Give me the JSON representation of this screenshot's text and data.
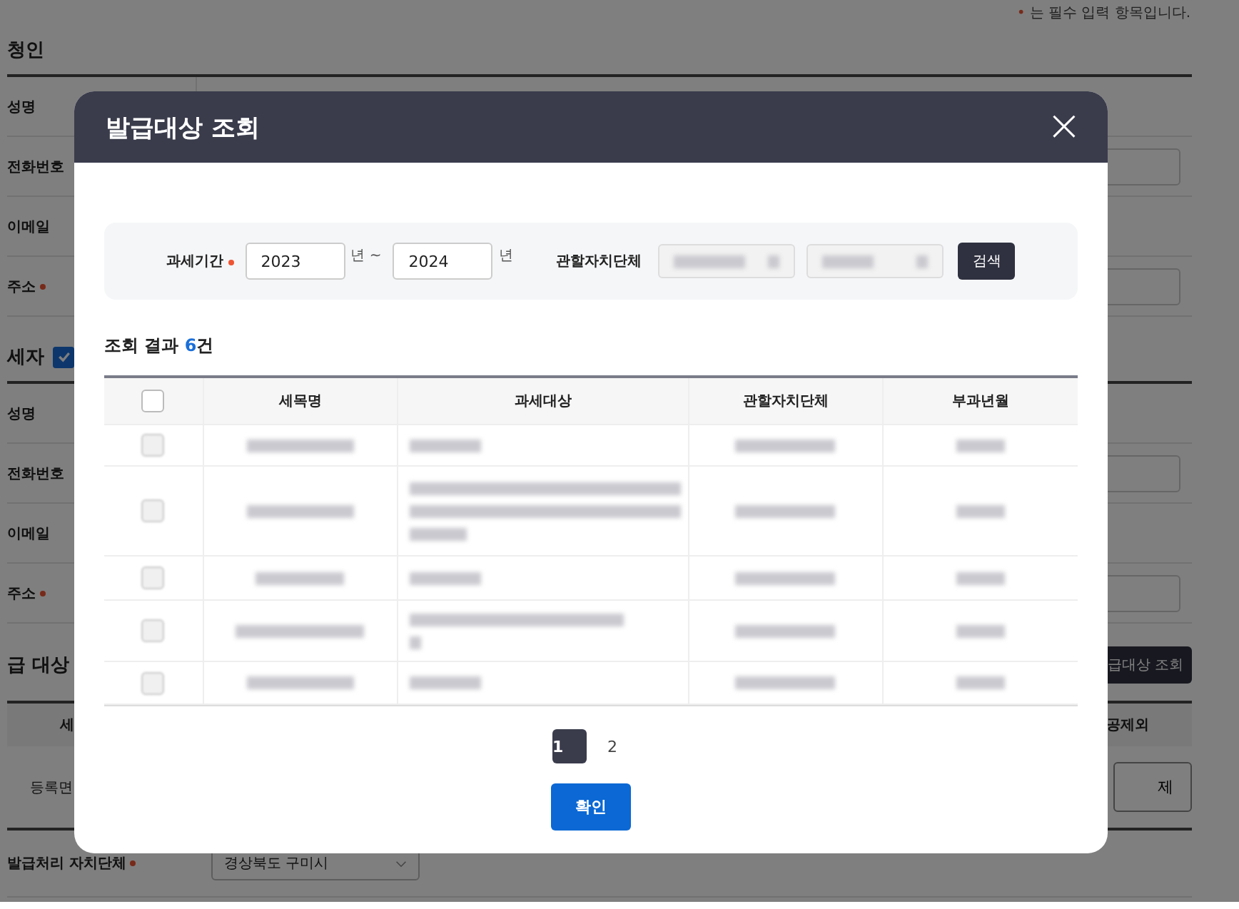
{
  "page": {
    "notice": {
      "mark": "•",
      "text": "는 필수 입력 항목입니다."
    },
    "applicant": {
      "title": "청인",
      "fields": [
        {
          "label": "성명",
          "required": false,
          "kind": "plain"
        },
        {
          "label": "전화번호",
          "required": false,
          "kind": "input"
        },
        {
          "label": "이메일",
          "required": false,
          "kind": "plain"
        },
        {
          "label": "주소",
          "required": true,
          "kind": "input"
        }
      ]
    },
    "taxpayer": {
      "title": "세자",
      "checked": true,
      "fields": [
        {
          "label": "성명",
          "required": false,
          "kind": "plain"
        },
        {
          "label": "전화번호",
          "required": false,
          "kind": "input"
        },
        {
          "label": "이메일",
          "required": false,
          "kind": "plain"
        },
        {
          "label": "주소",
          "required": true,
          "kind": "input"
        }
      ]
    },
    "target": {
      "title": "급 대상",
      "button": "급대상 조회",
      "columns": [
        "세",
        "공제외"
      ],
      "cell": "등록면",
      "row_button": "제"
    },
    "office": {
      "label": "발급처리 자치단체",
      "required": true,
      "select": "경상북도 구미시"
    }
  },
  "modal": {
    "title": "발급대상 조회",
    "close": "×",
    "search": {
      "period_label": "과세기간",
      "required": true,
      "from": "2023",
      "from_unit": "년 ~",
      "to": "2024",
      "to_unit": "년",
      "region_label": "관할자치단체",
      "button": "검색"
    },
    "result": {
      "prefix": "조회 결과 ",
      "count": "6",
      "suffix": "건"
    },
    "table": {
      "header_checked": false,
      "columns": [
        "세목명",
        "과세대상",
        "관할자치단체",
        "부과년월"
      ],
      "rows": [
        {
          "checked": false,
          "kind": "single"
        },
        {
          "checked": false,
          "kind": "triple"
        },
        {
          "checked": false,
          "kind": "single"
        },
        {
          "checked": false,
          "kind": "double"
        },
        {
          "checked": false,
          "kind": "single"
        }
      ]
    },
    "pages": [
      {
        "label": "1",
        "selected": true
      },
      {
        "label": "2",
        "selected": false
      }
    ],
    "confirm": "확인"
  }
}
